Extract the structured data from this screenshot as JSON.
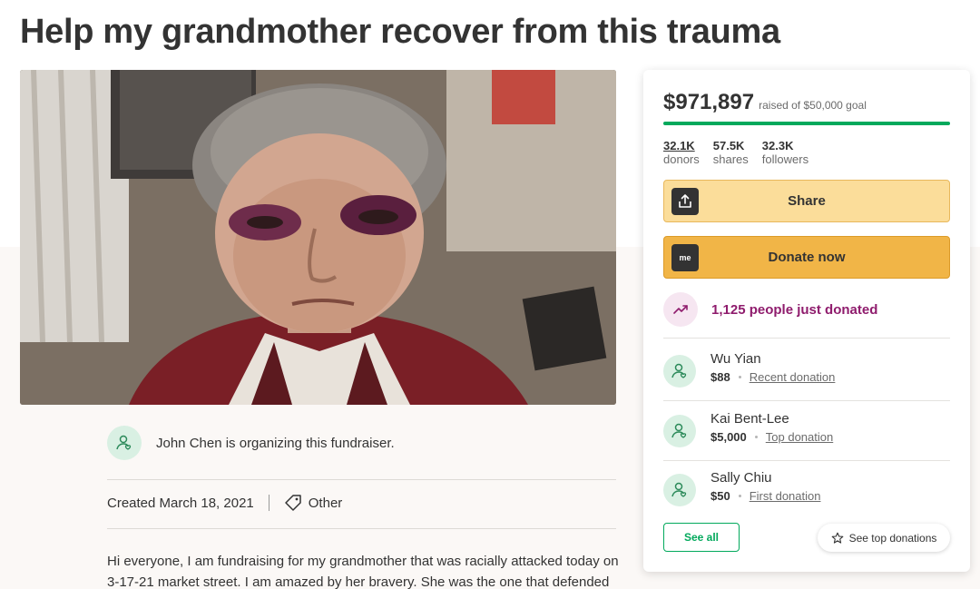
{
  "page": {
    "title": "Help my grandmother recover from this trauma"
  },
  "photo": {
    "icon": "campaign-photo"
  },
  "organizer": {
    "text": "John Chen is organizing this fundraiser."
  },
  "meta": {
    "created": "Created March 18, 2021",
    "category": "Other"
  },
  "story": {
    "text": "Hi everyone, I am fundraising for my grandmother that was racially attacked today on 3-17-21 market street. I am amazed by her bravery. She was the one that defended"
  },
  "donation_card": {
    "raised_amount": "$971,897",
    "raised_goal": "raised of $50,000 goal",
    "progress_fraction": 1.0,
    "stats": [
      {
        "value": "32.1K",
        "label": "donors"
      },
      {
        "value": "57.5K",
        "label": "shares"
      },
      {
        "value": "32.3K",
        "label": "followers"
      }
    ],
    "share_label": "Share",
    "donate_label": "Donate now",
    "donate_icon_text": "me",
    "recent_activity": "1,125 people just donated",
    "donors": [
      {
        "name": "Wu Yian",
        "amount": "$88",
        "tag": "Recent donation"
      },
      {
        "name": "Kai Bent-Lee",
        "amount": "$5,000",
        "tag": "Top donation"
      },
      {
        "name": "Sally Chiu",
        "amount": "$50",
        "tag": "First donation"
      }
    ],
    "see_all_label": "See all",
    "see_top_label": "See top donations"
  },
  "colors": {
    "brand_green": "#02a95c",
    "share_button": "#fbdd9a",
    "donate_button": "#f1b547",
    "trend_purple": "#8f1c6d",
    "avatar_green": "#d9f0e3"
  }
}
